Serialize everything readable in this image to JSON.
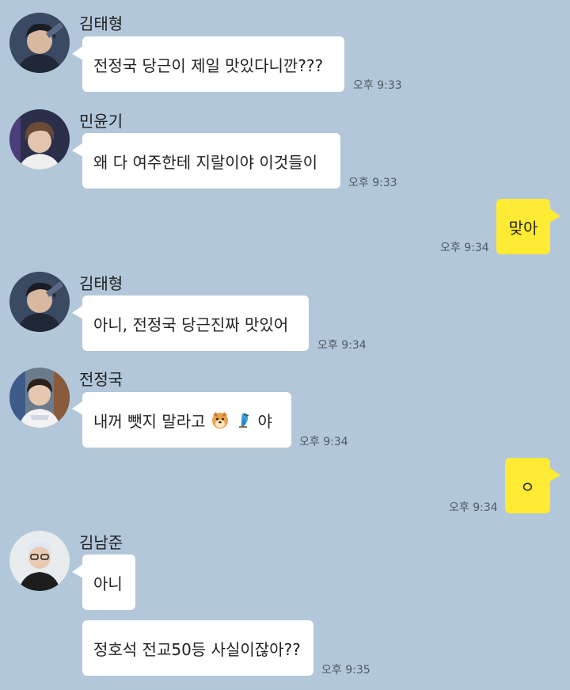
{
  "chat": {
    "messages": [
      {
        "sender": "김태형",
        "text": "전정국 당근이 제일 맛있다니깐???",
        "time": "오후 9:33"
      },
      {
        "sender": "민윤기",
        "text": "왜 다 여주한테 지랄이야 이것들이",
        "time": "오후 9:33"
      },
      {
        "sender": "me",
        "text": "맞아",
        "time": "오후 9:34"
      },
      {
        "sender": "김태형",
        "text": "아니, 전정국 당근진짜 맛있어",
        "time": "오후 9:34"
      },
      {
        "sender": "전정국",
        "text": "내꺼 뺏지 말라고",
        "text_suffix": "야",
        "emojis": [
          "dog-face-emoji",
          "parrot-emoji"
        ],
        "time": "오후 9:34"
      },
      {
        "sender": "me",
        "text": "ㅇ",
        "time": "오후 9:34"
      },
      {
        "sender": "김남준",
        "text": "아니"
      },
      {
        "sender": "김남준",
        "text": "정호석 전교50등 사실이잖아??",
        "time": "오후 9:35"
      }
    ]
  },
  "colors": {
    "background": "#b2c7d9",
    "incoming_bubble": "#ffffff",
    "outgoing_bubble": "#ffeb33"
  },
  "icons": [
    "avatar-kim-taehyung",
    "avatar-min-yoongi",
    "avatar-jeon-jungkook",
    "avatar-kim-namjoon",
    "dog-face-emoji",
    "parrot-emoji"
  ]
}
